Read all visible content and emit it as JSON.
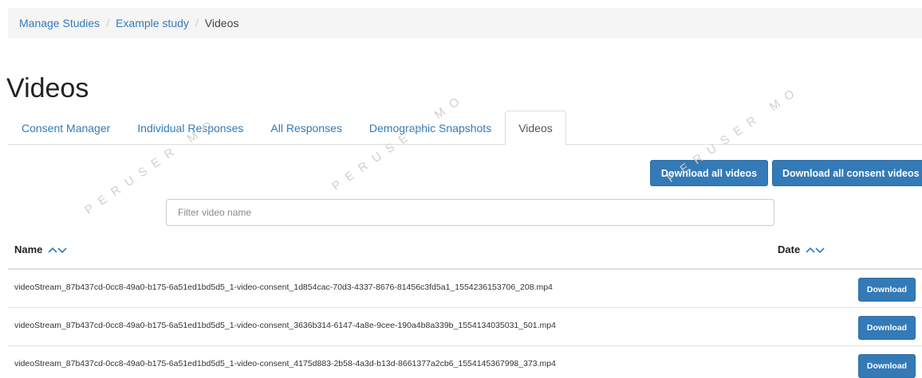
{
  "breadcrumb": {
    "items": [
      "Manage Studies",
      "Example study"
    ],
    "current": "Videos",
    "separator": "/"
  },
  "page": {
    "title": "Videos"
  },
  "tabs": [
    {
      "label": "Consent Manager"
    },
    {
      "label": "Individual Responses"
    },
    {
      "label": "All Responses"
    },
    {
      "label": "Demographic Snapshots"
    },
    {
      "label": "Videos",
      "active": true
    }
  ],
  "actions": {
    "download_all": "Download all videos",
    "download_consent": "Download all consent videos"
  },
  "filter": {
    "placeholder": "Filter video name",
    "value": ""
  },
  "table": {
    "headers": {
      "name": "Name",
      "date": "Date"
    },
    "rows": [
      {
        "filename": "videoStream_87b437cd-0cc8-49a0-b175-6a51ed1bd5d5_1-video-consent_1d854cac-70d3-4337-8676-81456c3fd5a1_1554236153706_208.mp4",
        "action": "Download"
      },
      {
        "filename": "videoStream_87b437cd-0cc8-49a0-b175-6a51ed1bd5d5_1-video-consent_3636b314-6147-4a8e-9cee-190a4b8a339b_1554134035031_501.mp4",
        "action": "Download"
      },
      {
        "filename": "videoStream_87b437cd-0cc8-49a0-b175-6a51ed1bd5d5_1-video-consent_4175d883-2b58-4a3d-b13d-8661377a2cb6_1554145367998_373.mp4",
        "action": "Download"
      }
    ]
  },
  "watermark_text": "PERUSER MO",
  "colors": {
    "primary": "#337ab7",
    "link": "#337ab7",
    "breadcrumb_bg": "#f5f5f5"
  }
}
